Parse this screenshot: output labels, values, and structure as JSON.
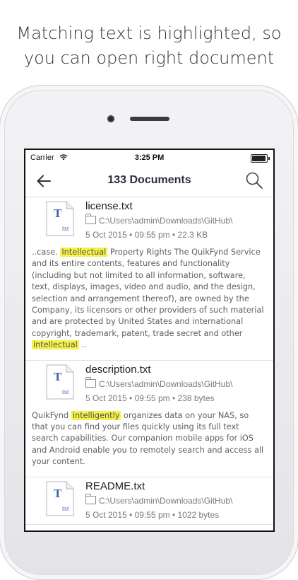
{
  "headline": {
    "line1": "Matching text is highlighted, so",
    "line2": "you can open right document"
  },
  "status": {
    "carrier": "Carrier",
    "time": "3:25 PM"
  },
  "nav": {
    "title": "133 Documents"
  },
  "documents": [
    {
      "name": "license.txt",
      "path": "C:\\Users\\admin\\Downloads\\GitHub\\",
      "meta": "5 Oct 2015 • 09:55 pm • 22.3 KB",
      "icon_letter": "T",
      "icon_ext": "txt",
      "snippet_before": "..case. ",
      "match": "Intellectual",
      "snippet_middle": " Property Rights The QuikFynd Service and its entire contents, features and functionality (including but not limited to all information, software, text, displays, images, video and audio, and the design, selection and arrangement thereof), are owned by the Company, its licensors or other providers of such material and are protected by United States and international copyright, trademark, patent, trade secret and other ",
      "match2": "intellectual",
      "snippet_after": " .."
    },
    {
      "name": "description.txt",
      "path": "C:\\Users\\admin\\Downloads\\GitHub\\",
      "meta": "5 Oct 2015 • 09:55 pm • 238 bytes",
      "icon_letter": "T",
      "icon_ext": "txt",
      "snippet_before": "QuikFynd ",
      "match": "intelligently",
      "snippet_after": " organizes data on your NAS, so that you can find your files quickly using its full text search capabilities. Our companion mobile apps for iOS and Android enable you to remotely search and access all your content."
    },
    {
      "name": "README.txt",
      "path": "C:\\Users\\admin\\Downloads\\GitHub\\",
      "meta": "5 Oct 2015 • 09:55 pm • 1022 bytes",
      "icon_letter": "T",
      "icon_ext": "txt"
    }
  ],
  "colors": {
    "highlight": "#f5f24a",
    "icon_blue": "#3b5fa6"
  },
  "icons": {
    "back": "arrow-left-icon",
    "search": "magnifier-icon",
    "file": "text-document-icon",
    "folder": "folder-icon"
  }
}
